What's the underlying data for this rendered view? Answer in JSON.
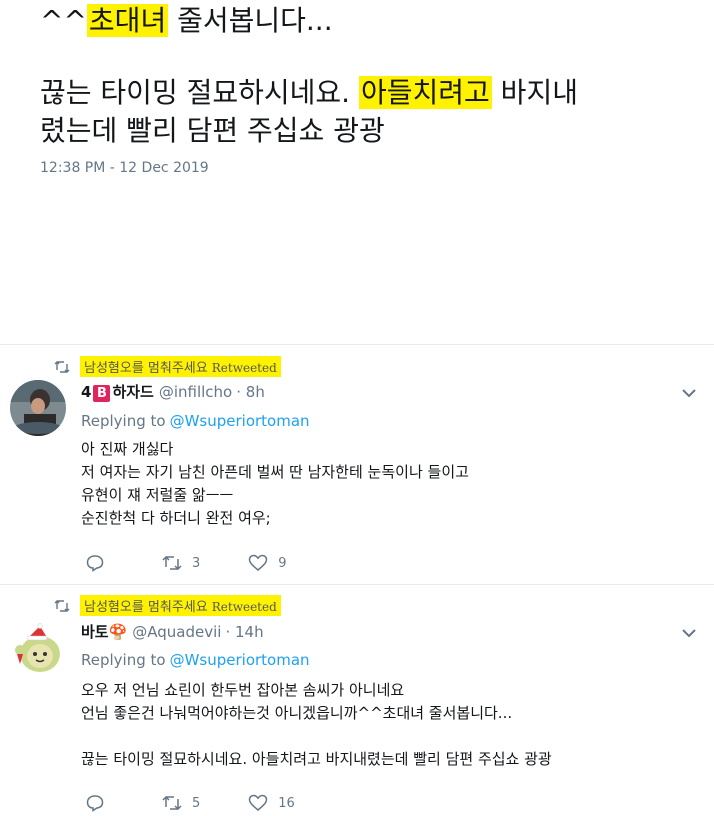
{
  "main_tweet": {
    "line1_prefix": "^^",
    "line1_highlight": "초대녀",
    "line1_suffix": " 줄서봅니다...",
    "line2_prefix": "끊는 타이밍 절묘하시네요. ",
    "line2_highlight": "아들치려고",
    "line2_suffix": " 바지내",
    "line3": "렸는데 빨리 담편 주십쇼 광광",
    "timestamp": "12:38 PM - 12 Dec 2019"
  },
  "tweets": [
    {
      "retweet_by": "남성혐오를 멈춰주세요",
      "retweet_word": "Retweeted",
      "name_prefix": "4",
      "badge": "B",
      "name_suffix": "하자드",
      "handle": "@infillcho",
      "time": "· 8h",
      "replying_label": "Replying to",
      "replying_handle": "@Wsuperiortoman",
      "lines": [
        "아 진짜 개싫다",
        "저 여자는 자기 남친 아픈데 벌써 딴 남자한테 눈독이나 들이고",
        "유현이 쟤 저럴줄 앎ㅡㅡ",
        "순진한척 다 하더니 완전 여우;"
      ],
      "retweets": "3",
      "likes": "9"
    },
    {
      "retweet_by": "남성혐오를 멈춰주세요",
      "retweet_word": "Retweeted",
      "name": "바토🍄",
      "handle": "@Aquadevii",
      "time": "· 14h",
      "replying_label": "Replying to",
      "replying_handle": "@Wsuperiortoman",
      "lines": [
        "오우 저 언님 쇼린이 한두번 잡아본 솜씨가 아니네요",
        "언님 좋은건 나눠먹어야하는것 아니겠읍니까^^초대녀 줄서봅니다...",
        "",
        "끊는 타이밍 절묘하시네요. 아들치려고 바지내렸는데 빨리 담편 주십쇼 광광"
      ],
      "retweets": "5",
      "likes": "16"
    }
  ],
  "icons": {
    "retweet": "retweet-icon",
    "reply": "reply-icon",
    "like": "heart-icon",
    "menu": "chevron-down-icon"
  },
  "colors": {
    "highlight": "#fff200",
    "link": "#1da1f2",
    "muted": "#657786",
    "badge": "#e0245e"
  }
}
